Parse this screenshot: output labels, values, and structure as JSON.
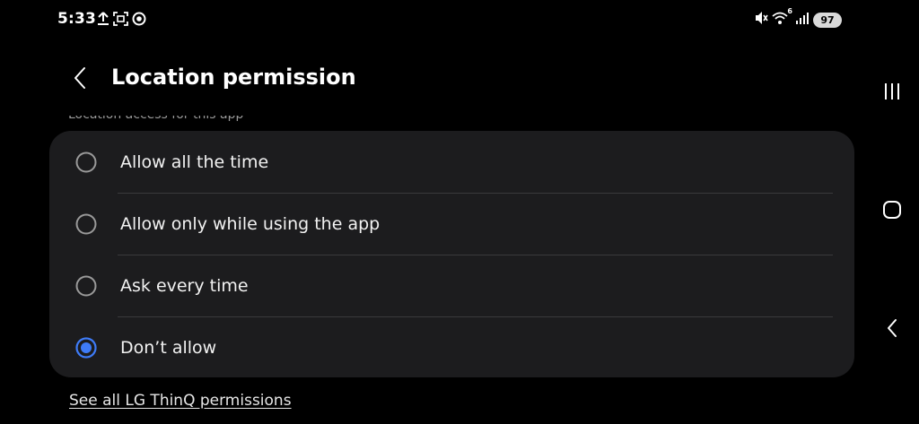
{
  "status_bar": {
    "time": "5:33",
    "left_icons": [
      "upload-icon",
      "screenshot-icon",
      "sync-icon"
    ],
    "right_icons": [
      "mute-icon",
      "wifi-6-icon",
      "signal-icon"
    ],
    "wifi_badge": "6",
    "battery": "97"
  },
  "header": {
    "title": "Location permission"
  },
  "section_label": "Location access for this app",
  "options": [
    {
      "label": "Allow all the time",
      "selected": false
    },
    {
      "label": "Allow only while using the app",
      "selected": false
    },
    {
      "label": "Ask every time",
      "selected": false
    },
    {
      "label": "Don’t allow",
      "selected": true
    }
  ],
  "see_all_link": "See all LG ThinQ permissions",
  "colors": {
    "background": "#000000",
    "card": "#1c1c1e",
    "accent": "#3e7bf7",
    "divider": "#3a3a3c"
  },
  "nav_bar": [
    "recents-icon",
    "home-icon",
    "back-icon"
  ]
}
